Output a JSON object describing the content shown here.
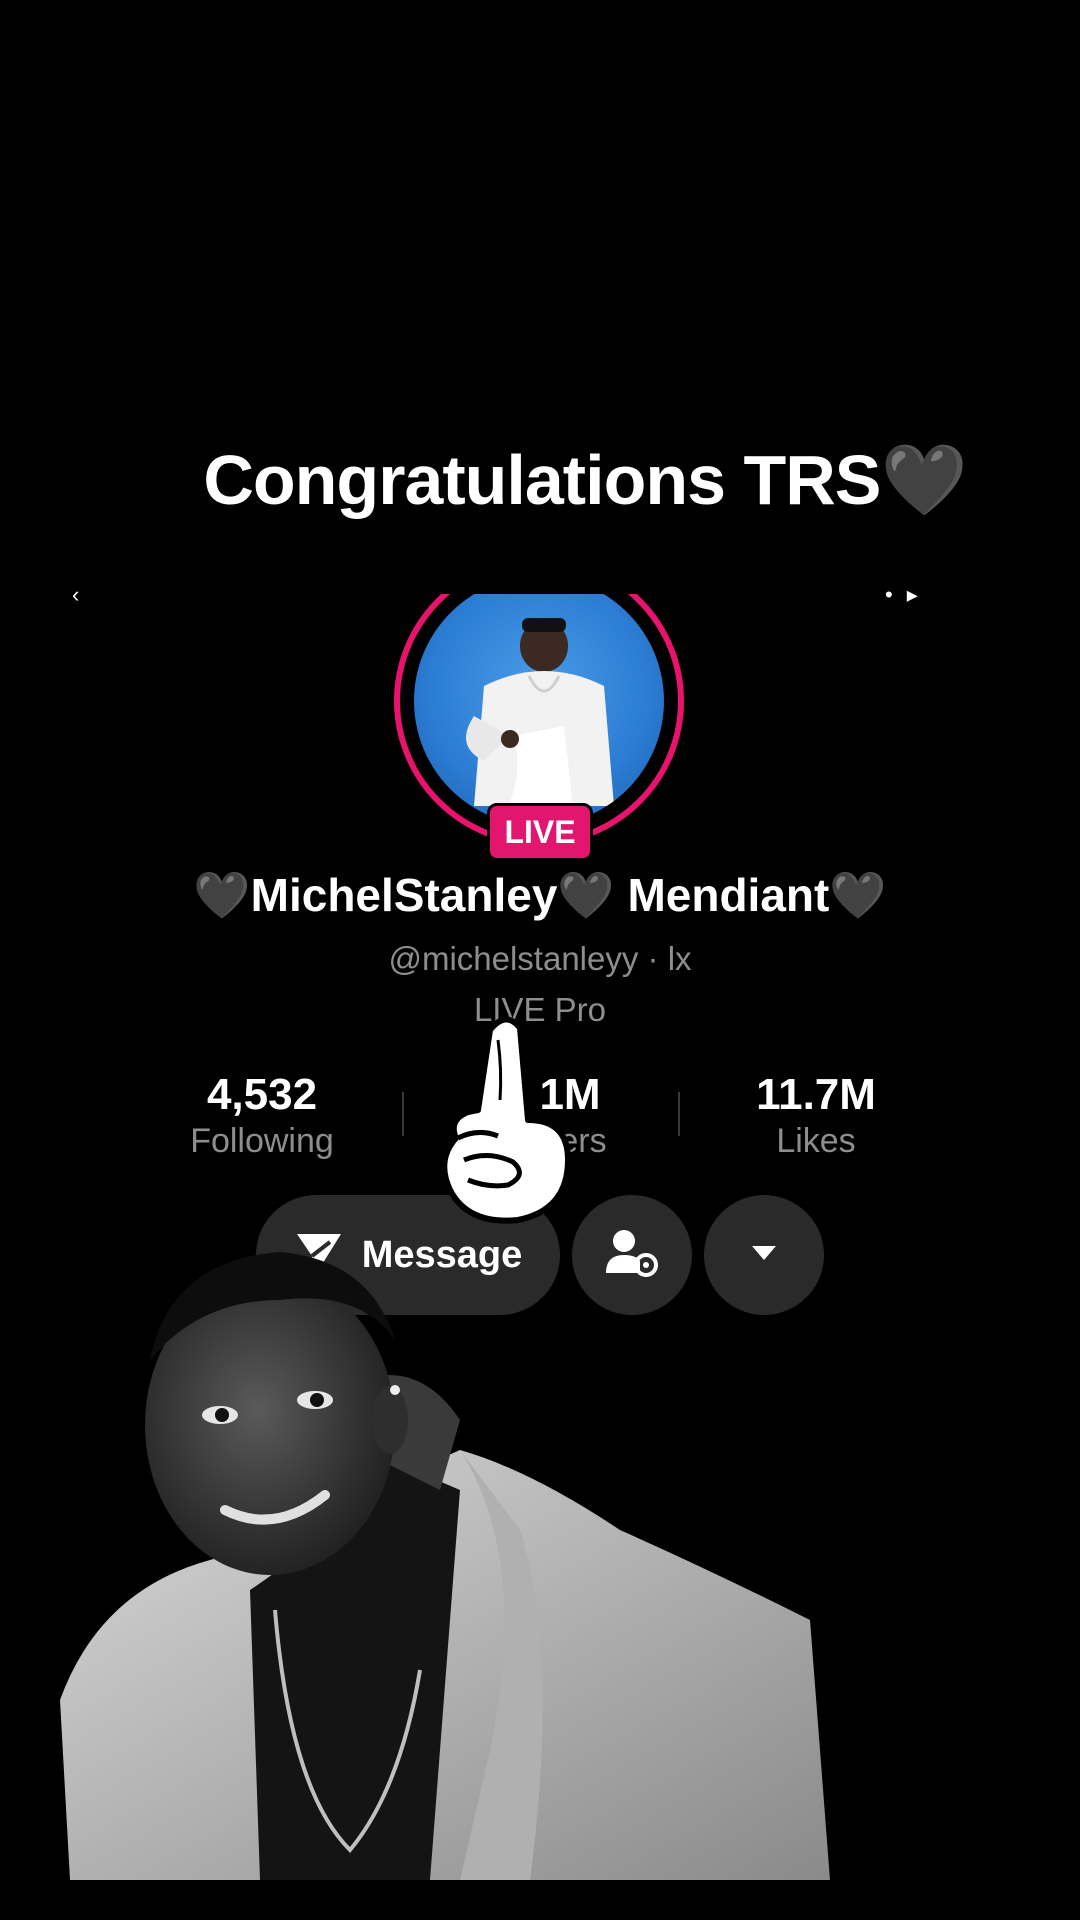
{
  "overlay": {
    "caption": "Congratulations TRS🖤"
  },
  "profile": {
    "display_name": "🖤MichelStanley🖤 Mendiant🖤",
    "username": "@michelstanleyy · lx",
    "subtitle": "LIVE Pro",
    "live_badge": "LIVE",
    "ring_color": "#e7136c",
    "badge_color": "#e2166f"
  },
  "stats": {
    "following": {
      "value": "4,532",
      "label": "Following"
    },
    "followers": {
      "value": "1M",
      "label": "ers"
    },
    "likes": {
      "value": "11.7M",
      "label": "Likes"
    }
  },
  "actions": {
    "message_label": "Message",
    "message_icon": "send-icon",
    "friend_icon": "person-settings-icon",
    "more_icon": "caret-down-icon"
  },
  "sticker": {
    "icon": "pointing-hand-icon"
  }
}
